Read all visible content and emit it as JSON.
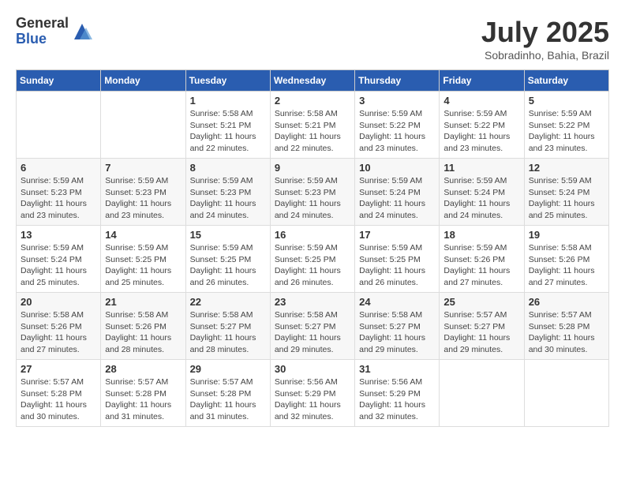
{
  "logo": {
    "general": "General",
    "blue": "Blue"
  },
  "title": {
    "month_year": "July 2025",
    "location": "Sobradinho, Bahia, Brazil"
  },
  "weekdays": [
    "Sunday",
    "Monday",
    "Tuesday",
    "Wednesday",
    "Thursday",
    "Friday",
    "Saturday"
  ],
  "weeks": [
    [
      {
        "day": "",
        "info": ""
      },
      {
        "day": "",
        "info": ""
      },
      {
        "day": "1",
        "info": "Sunrise: 5:58 AM\nSunset: 5:21 PM\nDaylight: 11 hours\nand 22 minutes."
      },
      {
        "day": "2",
        "info": "Sunrise: 5:58 AM\nSunset: 5:21 PM\nDaylight: 11 hours\nand 22 minutes."
      },
      {
        "day": "3",
        "info": "Sunrise: 5:59 AM\nSunset: 5:22 PM\nDaylight: 11 hours\nand 23 minutes."
      },
      {
        "day": "4",
        "info": "Sunrise: 5:59 AM\nSunset: 5:22 PM\nDaylight: 11 hours\nand 23 minutes."
      },
      {
        "day": "5",
        "info": "Sunrise: 5:59 AM\nSunset: 5:22 PM\nDaylight: 11 hours\nand 23 minutes."
      }
    ],
    [
      {
        "day": "6",
        "info": "Sunrise: 5:59 AM\nSunset: 5:23 PM\nDaylight: 11 hours\nand 23 minutes."
      },
      {
        "day": "7",
        "info": "Sunrise: 5:59 AM\nSunset: 5:23 PM\nDaylight: 11 hours\nand 23 minutes."
      },
      {
        "day": "8",
        "info": "Sunrise: 5:59 AM\nSunset: 5:23 PM\nDaylight: 11 hours\nand 24 minutes."
      },
      {
        "day": "9",
        "info": "Sunrise: 5:59 AM\nSunset: 5:23 PM\nDaylight: 11 hours\nand 24 minutes."
      },
      {
        "day": "10",
        "info": "Sunrise: 5:59 AM\nSunset: 5:24 PM\nDaylight: 11 hours\nand 24 minutes."
      },
      {
        "day": "11",
        "info": "Sunrise: 5:59 AM\nSunset: 5:24 PM\nDaylight: 11 hours\nand 24 minutes."
      },
      {
        "day": "12",
        "info": "Sunrise: 5:59 AM\nSunset: 5:24 PM\nDaylight: 11 hours\nand 25 minutes."
      }
    ],
    [
      {
        "day": "13",
        "info": "Sunrise: 5:59 AM\nSunset: 5:24 PM\nDaylight: 11 hours\nand 25 minutes."
      },
      {
        "day": "14",
        "info": "Sunrise: 5:59 AM\nSunset: 5:25 PM\nDaylight: 11 hours\nand 25 minutes."
      },
      {
        "day": "15",
        "info": "Sunrise: 5:59 AM\nSunset: 5:25 PM\nDaylight: 11 hours\nand 26 minutes."
      },
      {
        "day": "16",
        "info": "Sunrise: 5:59 AM\nSunset: 5:25 PM\nDaylight: 11 hours\nand 26 minutes."
      },
      {
        "day": "17",
        "info": "Sunrise: 5:59 AM\nSunset: 5:25 PM\nDaylight: 11 hours\nand 26 minutes."
      },
      {
        "day": "18",
        "info": "Sunrise: 5:59 AM\nSunset: 5:26 PM\nDaylight: 11 hours\nand 27 minutes."
      },
      {
        "day": "19",
        "info": "Sunrise: 5:58 AM\nSunset: 5:26 PM\nDaylight: 11 hours\nand 27 minutes."
      }
    ],
    [
      {
        "day": "20",
        "info": "Sunrise: 5:58 AM\nSunset: 5:26 PM\nDaylight: 11 hours\nand 27 minutes."
      },
      {
        "day": "21",
        "info": "Sunrise: 5:58 AM\nSunset: 5:26 PM\nDaylight: 11 hours\nand 28 minutes."
      },
      {
        "day": "22",
        "info": "Sunrise: 5:58 AM\nSunset: 5:27 PM\nDaylight: 11 hours\nand 28 minutes."
      },
      {
        "day": "23",
        "info": "Sunrise: 5:58 AM\nSunset: 5:27 PM\nDaylight: 11 hours\nand 29 minutes."
      },
      {
        "day": "24",
        "info": "Sunrise: 5:58 AM\nSunset: 5:27 PM\nDaylight: 11 hours\nand 29 minutes."
      },
      {
        "day": "25",
        "info": "Sunrise: 5:57 AM\nSunset: 5:27 PM\nDaylight: 11 hours\nand 29 minutes."
      },
      {
        "day": "26",
        "info": "Sunrise: 5:57 AM\nSunset: 5:28 PM\nDaylight: 11 hours\nand 30 minutes."
      }
    ],
    [
      {
        "day": "27",
        "info": "Sunrise: 5:57 AM\nSunset: 5:28 PM\nDaylight: 11 hours\nand 30 minutes."
      },
      {
        "day": "28",
        "info": "Sunrise: 5:57 AM\nSunset: 5:28 PM\nDaylight: 11 hours\nand 31 minutes."
      },
      {
        "day": "29",
        "info": "Sunrise: 5:57 AM\nSunset: 5:28 PM\nDaylight: 11 hours\nand 31 minutes."
      },
      {
        "day": "30",
        "info": "Sunrise: 5:56 AM\nSunset: 5:29 PM\nDaylight: 11 hours\nand 32 minutes."
      },
      {
        "day": "31",
        "info": "Sunrise: 5:56 AM\nSunset: 5:29 PM\nDaylight: 11 hours\nand 32 minutes."
      },
      {
        "day": "",
        "info": ""
      },
      {
        "day": "",
        "info": ""
      }
    ]
  ]
}
